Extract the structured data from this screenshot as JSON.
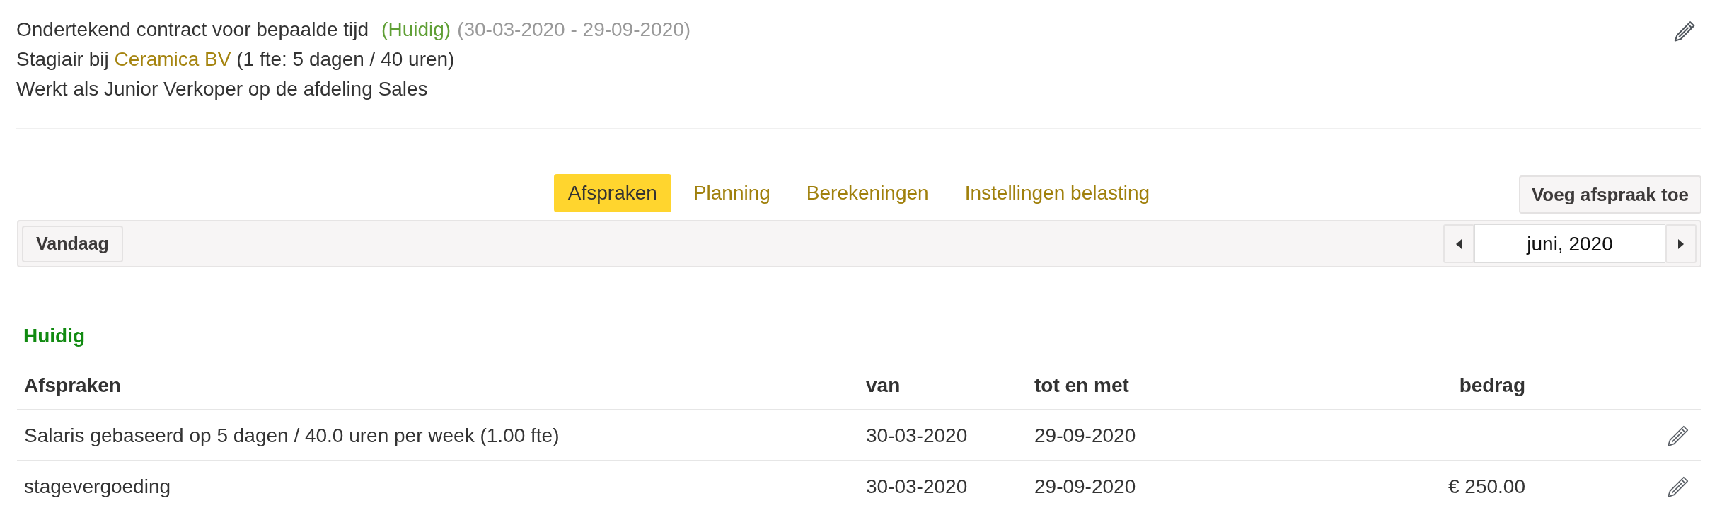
{
  "contract": {
    "title": "Ondertekend contract voor bepaalde tijd",
    "status": "(Huidig)",
    "period": "(30-03-2020 - 29-09-2020)",
    "employment": {
      "prefix": "Stagiair bij",
      "employer": "Ceramica BV",
      "suffix": "(1 fte: 5 dagen / 40 uren)"
    },
    "description": "Werkt als Junior Verkoper op de afdeling Sales"
  },
  "tabs": [
    {
      "label": "Afspraken",
      "selected": true
    },
    {
      "label": "Planning",
      "selected": false
    },
    {
      "label": "Berekeningen",
      "selected": false
    },
    {
      "label": "Instellingen belasting",
      "selected": false
    }
  ],
  "add_button": "Voeg afspraak toe",
  "toolbar": {
    "today_button": "Vandaag",
    "month": "juni, 2020"
  },
  "section": {
    "heading": "Huidig",
    "columns": [
      "Afspraken",
      "van",
      "tot en met",
      "bedrag"
    ],
    "rows": [
      {
        "description": "Salaris gebaseerd op 5 dagen / 40.0 uren per week (1.00 fte)",
        "from": "30-03-2020",
        "to": "29-09-2020"
      },
      {
        "description": "stagevergoeding",
        "from": "30-03-2020",
        "to": "29-09-2020",
        "amount": "€ 250.00"
      }
    ]
  }
}
